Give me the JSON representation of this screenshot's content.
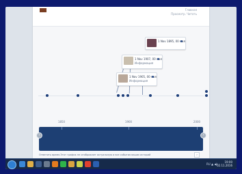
{
  "page": {
    "header": {
      "link1": "Главная",
      "link2": "Просмотр. Читать"
    },
    "cards": [
      {
        "title": "1 Nov 1895, 00 мая",
        "subtitle": "",
        "thumb_color": "#6a4250"
      },
      {
        "title": "1 Nov 1907, 00 мая",
        "subtitle": "Информация",
        "thumb_color": "#c9bfae"
      },
      {
        "title": "1 Nov 1905, 00 мая",
        "subtitle": "Информация",
        "thumb_color": "#b9a89a"
      }
    ],
    "timeline_ticks": [
      "1850",
      "1900",
      "2000"
    ],
    "footer_text": "Отметить время   Этот график не отображает актуальную и все события ваших историй",
    "nav_left_label": "‹",
    "nav_right_label": "›"
  },
  "taskbar": {
    "tray_text": "RU  ▲  ◀)",
    "time": "19:00",
    "date": "02.11.2016",
    "icons": [
      "ie-icon",
      "explorer-icon",
      "media-icon",
      "calculator-icon",
      "vlc-icon",
      "whatsapp-icon",
      "folder-icon",
      "paint-icon",
      "chrome-icon",
      "word-icon"
    ]
  },
  "colors": {
    "accent": "#1d3f73",
    "background": "#0d1a6e"
  }
}
